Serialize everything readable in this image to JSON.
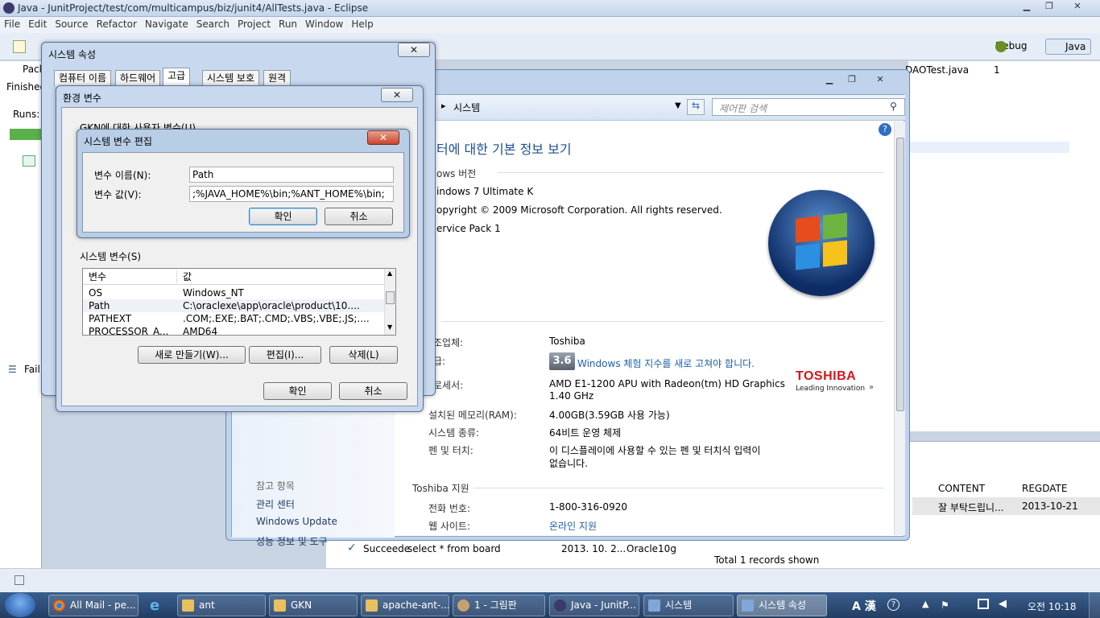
{
  "eclipse": {
    "title": "Java - JunitProject/test/com/multicampus/biz/junit4/AllTests.java - Eclipse",
    "menu": [
      "File",
      "Edit",
      "Source",
      "Refactor",
      "Navigate",
      "Search",
      "Project",
      "Run",
      "Window",
      "Help"
    ],
    "perspectives": [
      "Debug",
      "Java"
    ],
    "left_tab": "Pack",
    "left_finished": "Finished",
    "left_runs": "Runs:",
    "left_fail": "Fail",
    "editor_tab": "DAOTest.java",
    "editor_tab_more": "1",
    "table_headers": [
      "CONTENT",
      "REGDATE"
    ],
    "table_row": [
      "잘 부탁드립니...",
      "2013-10-21"
    ],
    "total": "Total 1 records shown",
    "history_row": [
      "Succeede",
      "select * from board",
      "2013. 10. 2...",
      "Oracle10g"
    ]
  },
  "control_panel": {
    "breadcrumb": "시스템",
    "search_placeholder": "제어판 검색",
    "heading": "터에 대한 기본 정보 보기",
    "edition_section": "ows 버전",
    "edition": "indows 7 Ultimate K",
    "copyright": "opyright © 2009 Microsoft Corporation. All rights reserved.",
    "service_pack": "ervice Pack 1",
    "rows": [
      {
        "label": "조업체:",
        "value": "Toshiba"
      },
      {
        "label": "급:",
        "value": "Windows 체험 지수를 새로 고쳐야 합니다.",
        "badge": "3.6"
      },
      {
        "label": "로세서:",
        "value": "AMD E1-1200 APU with Radeon(tm) HD Graphics",
        "value2": "1.40 GHz"
      },
      {
        "label": "설치된 메모리(RAM):",
        "value": "4.00GB(3.59GB 사용 가능)"
      },
      {
        "label": "시스템 종류:",
        "value": "64비트 운영 체제"
      },
      {
        "label": "펜 및 터치:",
        "value": "이 디스플레이에 사용할 수 있는 펜 및 터치식 입력이",
        "value2": "없습니다."
      }
    ],
    "oem_logo": "TOSHIBA",
    "oem_slogan": "Leading Innovation",
    "support_section": "Toshiba 지원",
    "support_rows": [
      {
        "label": "전화 번호:",
        "value": "1-800-316-0920"
      },
      {
        "label": "웹 사이트:",
        "value": "온라인 지원"
      }
    ],
    "see_also": "참고 항목",
    "see_also_links": [
      "관리 센터",
      "Windows Update",
      "성능 정보 및 도구"
    ]
  },
  "sys_props": {
    "title": "시스템 속성",
    "tabs": [
      "컴퓨터 이름",
      "하드웨어",
      "고급",
      "시스템 보호",
      "원격"
    ]
  },
  "env_vars": {
    "title": "환경 변수",
    "user_section": "GKN에 대한 사용자 변수(U)",
    "system_section": "시스템 변수(S)",
    "col_var": "변수",
    "col_val": "값",
    "rows": [
      {
        "name": "OS",
        "value": "Windows_NT"
      },
      {
        "name": "Path",
        "value": "C:\\oraclexe\\app\\oracle\\product\\10...."
      },
      {
        "name": "PATHEXT",
        "value": ".COM;.EXE;.BAT;.CMD;.VBS;.VBE;.JS;...."
      },
      {
        "name": "PROCESSOR_A...",
        "value": "AMD64"
      }
    ],
    "new_btn": "새로 만들기(W)...",
    "edit_btn": "편집(I)...",
    "delete_btn": "삭제(L)",
    "ok": "확인",
    "cancel": "취소"
  },
  "edit_var": {
    "title": "시스템 변수 편집",
    "name_label": "변수 이름(N):",
    "name_value": "Path",
    "value_label": "변수 값(V):",
    "value_value": ";%JAVA_HOME%\\bin;%ANT_HOME%\\bin;",
    "ok": "확인",
    "cancel": "취소"
  },
  "taskbar": {
    "items": [
      "All Mail - pe...",
      "ant",
      "GKN",
      "apache-ant-...",
      "1 - 그림판",
      "Java - JunitP...",
      "시스템",
      "시스템 속성"
    ],
    "lang": "A 漢",
    "clock": "오전 10:18"
  },
  "colors": {
    "toshiba_red": "#d7141a",
    "link_blue": "#1f5fa8",
    "title_blue": "#1e4e8c"
  }
}
